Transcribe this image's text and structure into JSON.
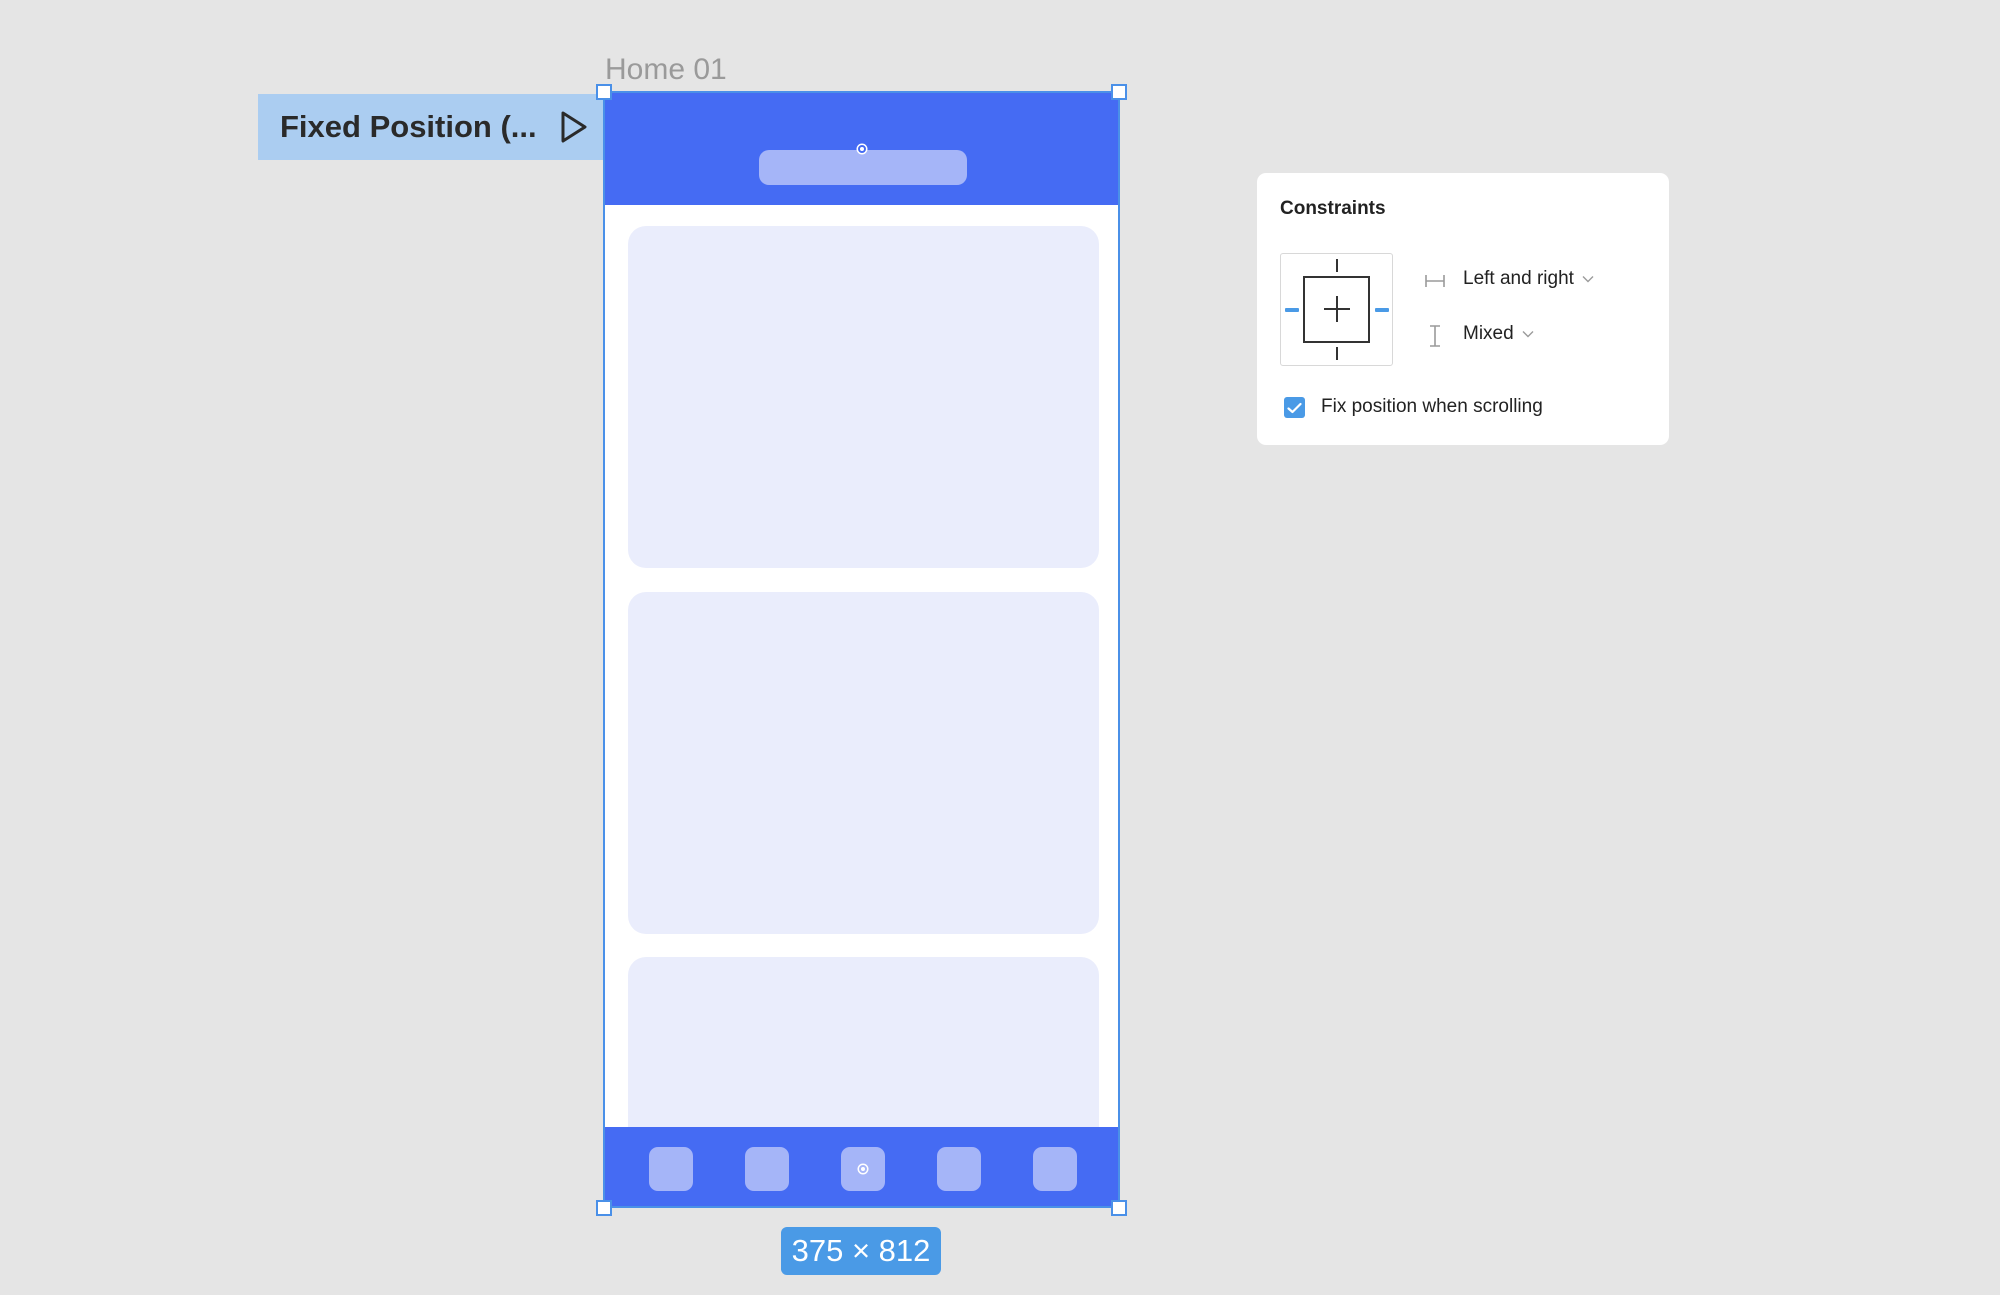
{
  "canvas": {
    "frame_name": "Home 01",
    "frame_size": "375 × 812",
    "flow_starting_point": "Fixed Position (...",
    "selection_color": "#4a90e8",
    "canvas_background": "#e5e5e5"
  },
  "mockup": {
    "primary_color": "#456bf3",
    "accent_color": "#a5b5f8",
    "card_color": "#eaedfc",
    "cards_visible": 3,
    "nav_items_count": 5
  },
  "constraints_panel": {
    "title": "Constraints",
    "horizontal": {
      "icon": "horizontal-constraint-icon",
      "value": "Left and right"
    },
    "vertical": {
      "icon": "vertical-constraint-icon",
      "value": "Mixed"
    },
    "fix_position": {
      "label": "Fix position when scrolling",
      "checked": true
    }
  }
}
